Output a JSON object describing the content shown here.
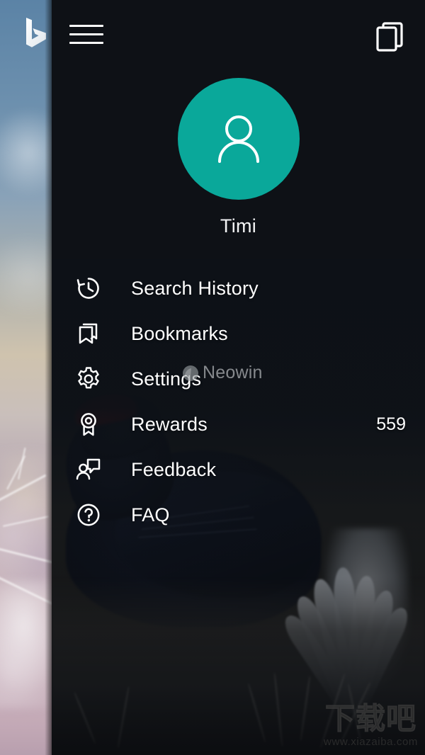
{
  "app": {
    "name": "Bing",
    "theme": "dark",
    "accent_color": "#0aa89a",
    "background_color": "#0d1117",
    "text_color": "#ffffff"
  },
  "peek": {
    "logo_icon": "bing-logo-icon"
  },
  "top_bar": {
    "menu_icon": "hamburger-menu-icon",
    "tabs_icon": "tabs-stack-icon"
  },
  "profile": {
    "avatar_icon": "person-outline-icon",
    "username": "Timi"
  },
  "menu": {
    "items": [
      {
        "id": "search-history",
        "icon": "history-clock-icon",
        "label": "Search History",
        "value": ""
      },
      {
        "id": "bookmarks",
        "icon": "bookmarks-icon",
        "label": "Bookmarks",
        "value": ""
      },
      {
        "id": "settings",
        "icon": "gear-icon",
        "label": "Settings",
        "value": ""
      },
      {
        "id": "rewards",
        "icon": "award-ribbon-icon",
        "label": "Rewards",
        "value": "559"
      },
      {
        "id": "feedback",
        "icon": "feedback-person-icon",
        "label": "Feedback",
        "value": ""
      },
      {
        "id": "faq",
        "icon": "question-circle-icon",
        "label": "FAQ",
        "value": ""
      }
    ]
  },
  "watermarks": {
    "neowin": {
      "text": "Neowin",
      "icon": "neowin-logo-icon"
    },
    "xiazaiba": {
      "text": "下载吧",
      "url": "www.xiazaiba.com"
    }
  }
}
